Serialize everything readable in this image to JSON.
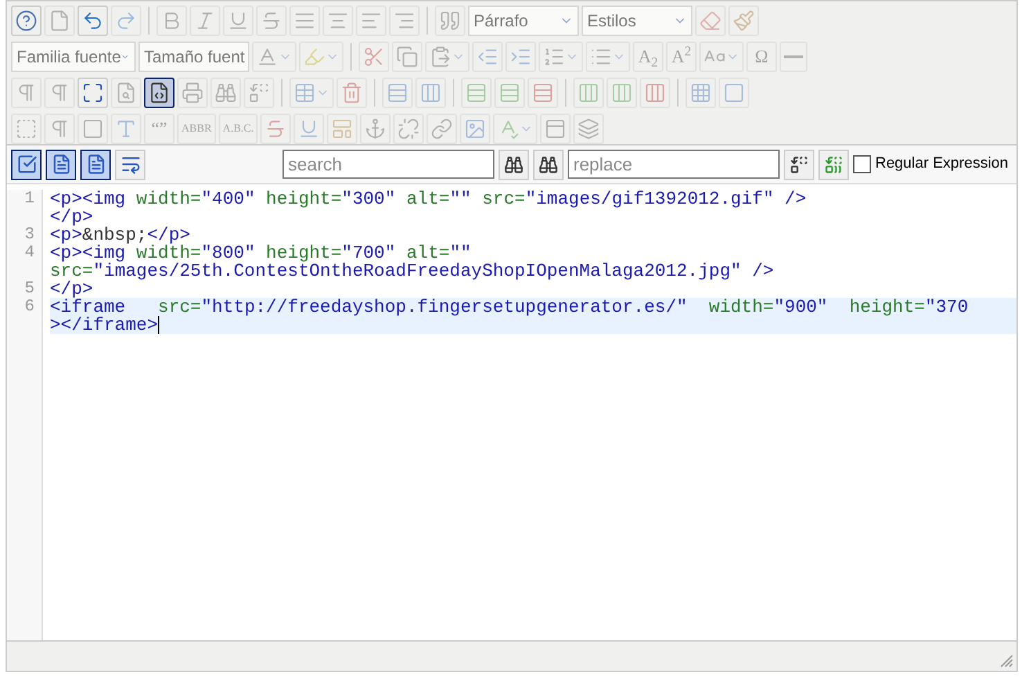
{
  "toolbar": {
    "rows": [
      {
        "items": [
          {
            "kind": "icon",
            "disabled": false,
            "active": false
          },
          {
            "kind": "icon",
            "disabled": true,
            "active": false
          },
          {
            "kind": "icon",
            "disabled": false,
            "active": false
          },
          {
            "kind": "icon",
            "disabled": true,
            "active": false
          },
          {
            "kind": "separator"
          },
          {
            "kind": "icon",
            "disabled": true,
            "active": false
          },
          {
            "kind": "icon",
            "disabled": true,
            "active": false
          },
          {
            "kind": "icon",
            "disabled": true,
            "active": false
          },
          {
            "kind": "icon",
            "disabled": true,
            "active": false
          },
          {
            "kind": "icon",
            "disabled": true,
            "active": false
          },
          {
            "kind": "icon",
            "disabled": true,
            "active": false
          },
          {
            "kind": "icon",
            "disabled": true,
            "active": false
          },
          {
            "kind": "icon",
            "disabled": true,
            "active": false
          },
          {
            "kind": "separator"
          },
          {
            "kind": "icon",
            "disabled": true,
            "active": false
          },
          {
            "kind": "select",
            "value": "Párrafo",
            "disabled": true
          },
          {
            "kind": "select",
            "value": "Estilos",
            "disabled": true
          },
          {
            "kind": "icon",
            "disabled": true,
            "active": false
          },
          {
            "kind": "icon",
            "disabled": true,
            "active": false
          }
        ]
      },
      {
        "items": [
          {
            "kind": "select",
            "value": "Familia fuente",
            "disabled": true
          },
          {
            "kind": "select",
            "value": "Tamaño fuent",
            "disabled": true
          },
          {
            "kind": "split",
            "disabled": true,
            "active": false
          },
          {
            "kind": "split",
            "disabled": true,
            "active": false
          },
          {
            "kind": "separator"
          },
          {
            "kind": "icon",
            "disabled": true,
            "active": false
          },
          {
            "kind": "icon",
            "disabled": true,
            "active": false
          },
          {
            "kind": "split",
            "disabled": true,
            "active": false
          },
          {
            "kind": "icon",
            "disabled": true,
            "active": false
          },
          {
            "kind": "icon",
            "disabled": true,
            "active": false
          },
          {
            "kind": "split",
            "disabled": true,
            "active": false
          },
          {
            "kind": "split",
            "disabled": true,
            "active": false
          },
          {
            "kind": "text",
            "label": "A$_{2}$",
            "disabled": true,
            "active": false
          },
          {
            "kind": "text",
            "label": "A$^{2}$",
            "disabled": true,
            "active": false
          },
          {
            "kind": "split",
            "disabled": true,
            "active": false
          },
          {
            "kind": "text",
            "label": "Ω",
            "disabled": true,
            "active": false
          },
          {
            "kind": "icon",
            "disabled": true,
            "active": false
          }
        ]
      },
      {
        "items": [
          {
            "kind": "icon",
            "disabled": true,
            "active": false
          },
          {
            "kind": "icon",
            "disabled": true,
            "active": false
          },
          {
            "kind": "icon",
            "disabled": false,
            "active": false
          },
          {
            "kind": "icon",
            "disabled": true,
            "active": false
          },
          {
            "kind": "icon",
            "disabled": false,
            "active": true
          },
          {
            "kind": "icon",
            "disabled": true,
            "active": false
          },
          {
            "kind": "icon",
            "disabled": true,
            "active": false
          },
          {
            "kind": "icon",
            "disabled": true,
            "active": false
          },
          {
            "kind": "separator"
          },
          {
            "kind": "split",
            "disabled": true,
            "active": false
          },
          {
            "kind": "icon",
            "disabled": true,
            "active": false
          },
          {
            "kind": "separator"
          },
          {
            "kind": "icon",
            "disabled": true,
            "active": false
          },
          {
            "kind": "icon",
            "disabled": true,
            "active": false
          },
          {
            "kind": "separator"
          },
          {
            "kind": "icon",
            "disabled": true,
            "active": false
          },
          {
            "kind": "icon",
            "disabled": true,
            "active": false
          },
          {
            "kind": "icon",
            "disabled": true,
            "active": false
          },
          {
            "kind": "separator"
          },
          {
            "kind": "icon",
            "disabled": true,
            "active": false
          },
          {
            "kind": "icon",
            "disabled": true,
            "active": false
          },
          {
            "kind": "icon",
            "disabled": true,
            "active": false
          },
          {
            "kind": "separator"
          },
          {
            "kind": "icon",
            "disabled": true,
            "active": false
          },
          {
            "kind": "icon",
            "disabled": true,
            "active": false
          }
        ]
      },
      {
        "items": [
          {
            "kind": "icon",
            "disabled": true,
            "active": false
          },
          {
            "kind": "icon",
            "disabled": true,
            "active": false
          },
          {
            "kind": "icon",
            "disabled": true,
            "active": false
          },
          {
            "kind": "icon",
            "disabled": true,
            "active": false
          },
          {
            "kind": "text",
            "label": "“”",
            "disabled": true,
            "active": false
          },
          {
            "kind": "small-text",
            "label": "ABBR",
            "disabled": true,
            "active": false
          },
          {
            "kind": "small-text",
            "label": "A.B.C.",
            "disabled": true,
            "active": false
          },
          {
            "kind": "icon",
            "disabled": true,
            "active": false
          },
          {
            "kind": "icon",
            "disabled": true,
            "active": false
          },
          {
            "kind": "icon",
            "disabled": true,
            "active": false
          },
          {
            "kind": "icon",
            "disabled": true,
            "active": false
          },
          {
            "kind": "icon",
            "disabled": true,
            "active": false
          },
          {
            "kind": "icon",
            "disabled": true,
            "active": false
          },
          {
            "kind": "icon",
            "disabled": true,
            "active": false
          },
          {
            "kind": "split",
            "disabled": true,
            "active": false
          },
          {
            "kind": "icon",
            "disabled": true,
            "active": false
          },
          {
            "kind": "icon",
            "disabled": true,
            "active": false
          }
        ]
      }
    ]
  },
  "code_toolbar": {
    "view_buttons": [
      {
        "selected": true
      },
      {
        "selected": true
      },
      {
        "selected": true
      },
      {
        "selected": false
      }
    ],
    "search": {
      "placeholder": "search"
    },
    "replace": {
      "placeholder": "replace"
    },
    "regex": {
      "label": "Regular Expression",
      "checked": false
    }
  },
  "code": {
    "lines": [
      {
        "number": "1",
        "active": false,
        "parts": [
          {
            "tokens": [
              {
                "kind": "tag",
                "text": "<p><img "
              },
              {
                "kind": "attr",
                "text": "width="
              },
              {
                "kind": "value",
                "text": "\"400\" "
              },
              {
                "kind": "attr",
                "text": "height="
              },
              {
                "kind": "value",
                "text": "\"300\" "
              },
              {
                "kind": "attr",
                "text": "alt="
              },
              {
                "kind": "value",
                "text": "\"\" "
              },
              {
                "kind": "attr",
                "text": "src="
              },
              {
                "kind": "value",
                "text": "\"images/gif1392012.gif\" "
              },
              {
                "kind": "tag",
                "text": "/>"
              }
            ]
          }
        ]
      },
      {
        "active": false,
        "parts": [
          {
            "tokens": [
              {
                "kind": "tag",
                "text": "</p>"
              }
            ]
          }
        ]
      },
      {
        "number": "3",
        "active": false,
        "parts": [
          {
            "tokens": [
              {
                "kind": "tag",
                "text": "<p>"
              },
              {
                "kind": "entity",
                "text": "&nbsp;"
              },
              {
                "kind": "tag",
                "text": "</p>"
              }
            ]
          }
        ]
      },
      {
        "number": "4",
        "active": false,
        "parts": [
          {
            "tokens": [
              {
                "kind": "tag",
                "text": "<p><img "
              },
              {
                "kind": "attr",
                "text": "width="
              },
              {
                "kind": "value",
                "text": "\"800\" "
              },
              {
                "kind": "attr",
                "text": "height="
              },
              {
                "kind": "value",
                "text": "\"700\" "
              },
              {
                "kind": "attr",
                "text": "alt="
              },
              {
                "kind": "value",
                "text": "\"\""
              }
            ]
          },
          {
            "tokens": [
              {
                "kind": "attr",
                "text": "src="
              },
              {
                "kind": "value",
                "text": "\"images/25th.ContestOntheRoadFreedayShopIOpenMalaga2012.jpg\" "
              },
              {
                "kind": "tag",
                "text": "/>"
              }
            ]
          }
        ]
      },
      {
        "number": "5",
        "active": false,
        "parts": [
          {
            "tokens": [
              {
                "kind": "tag",
                "text": "</p>"
              }
            ]
          }
        ]
      },
      {
        "number": "6",
        "active": true,
        "parts": [
          {
            "tokens": [
              {
                "kind": "tag",
                "text": "<iframe   "
              },
              {
                "kind": "attr",
                "text": "src="
              },
              {
                "kind": "value",
                "text": "\"http://freedayshop.fingersetupgenerator.es/\"  "
              },
              {
                "kind": "attr",
                "text": "width="
              },
              {
                "kind": "value",
                "text": "\"900\"  "
              },
              {
                "kind": "attr",
                "text": "height="
              },
              {
                "kind": "value",
                "text": "\"370"
              }
            ]
          },
          {
            "tokens": [
              {
                "kind": "tag",
                "text": "></iframe>"
              }
            ]
          }
        ]
      }
    ]
  }
}
